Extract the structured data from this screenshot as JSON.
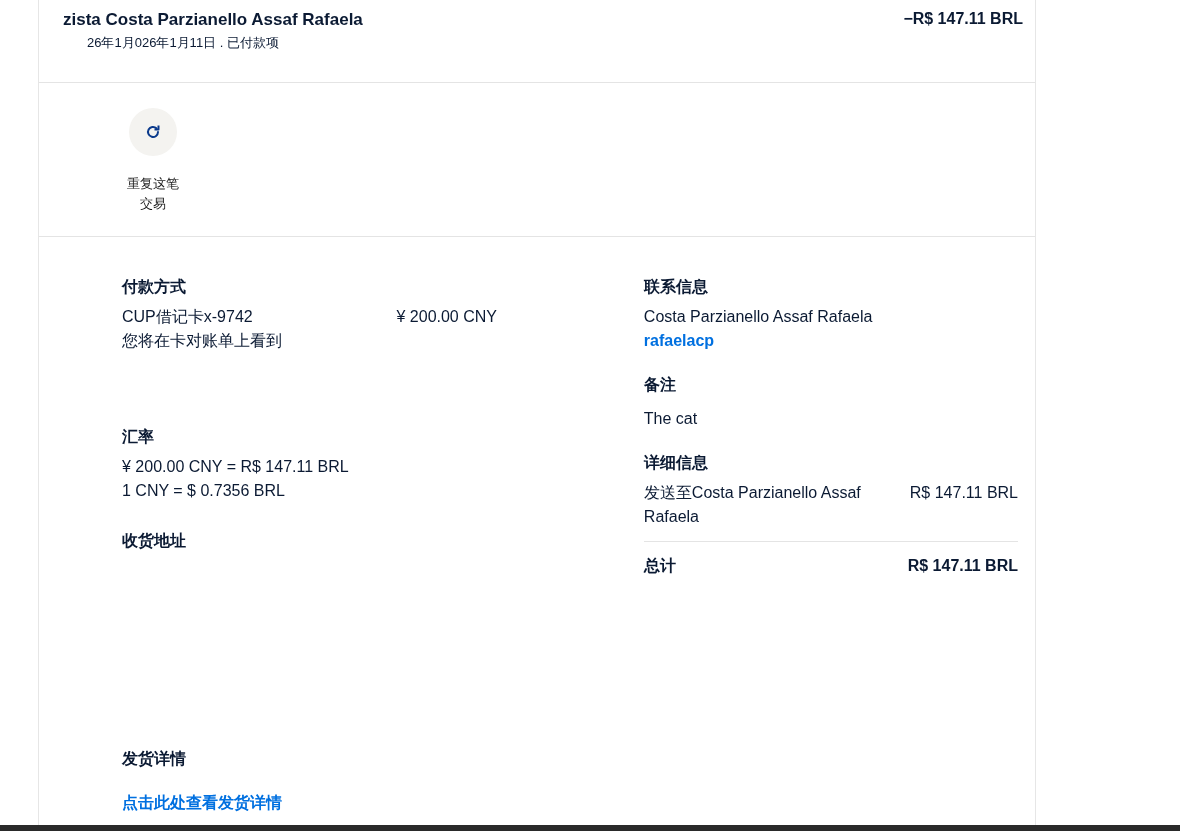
{
  "header": {
    "title": "zista Costa Parzianello Assaf Rafaela",
    "subtitle": "26年1月026年1月11日 . 已付款项",
    "amount": "−R$ 147.11 BRL"
  },
  "actions": [
    {
      "label": "重复这笔交易"
    }
  ],
  "payment": {
    "heading": "付款方式",
    "card": "CUP借记卡x-9742",
    "amount": "¥ 200.00 CNY",
    "note": "您将在卡对账单上看到"
  },
  "exchange": {
    "heading": "汇率",
    "lines": [
      "¥ 200.00 CNY = R$ 147.11 BRL",
      "1 CNY = $ 0.7356 BRL"
    ]
  },
  "shipping_address": {
    "heading": "收货地址"
  },
  "shipping_details": {
    "heading": "发货详情",
    "link": "点击此处查看发货详情"
  },
  "contact": {
    "heading": "联系信息",
    "name": "Costa Parzianello Assaf Rafaela",
    "email": "rafaelacp"
  },
  "notes": {
    "heading": "备注",
    "text": "The cat"
  },
  "details": {
    "heading": "详细信息",
    "items": [
      {
        "label": "发送至Costa Parzianello Assaf Rafaela",
        "amount": "R$ 147.11 BRL"
      }
    ],
    "total_label": "总计",
    "total": "R$ 147.11 BRL"
  }
}
